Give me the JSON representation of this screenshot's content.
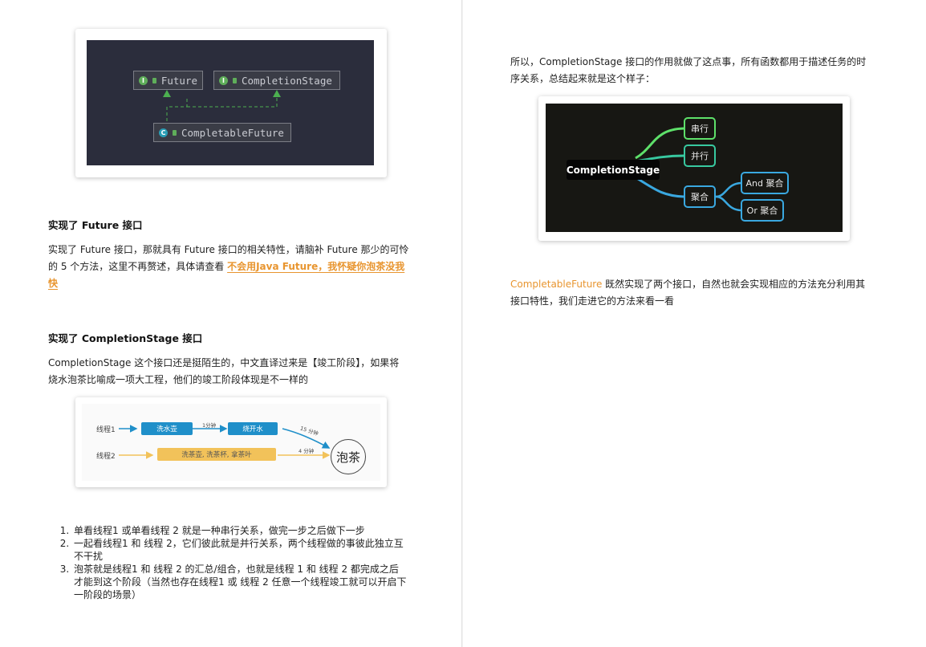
{
  "left_page": {
    "uml_figure": {
      "future": "Future",
      "completion_stage": "CompletionStage",
      "completable_future": "CompletableFuture",
      "interface_icon_letter": "I",
      "class_icon_letter": "C"
    },
    "section1": {
      "heading": "实现了 Future 接口",
      "para_line1": "实现了 Future 接口，那就具有 Future 接口的相关特性，请脑补 Future 那少的可怜",
      "para_line2_prefix": "的 5 个方法，这里不再赘述，具体请查看 ",
      "link_line1": "不会用Java Future，我怀疑你泡茶没我",
      "link_line2": "快"
    },
    "section2": {
      "heading": "实现了 CompletionStage 接口",
      "para_line1": "CompletionStage 这个接口还是挺陌生的，中文直译过来是【竣工阶段】，如果将",
      "para_line2": "烧水泡茶比喻成一项大工程，他们的竣工阶段体现是不一样的"
    },
    "tea_figure": {
      "thread1_label": "线程1",
      "thread2_label": "线程2",
      "step_wash_kettle": "洗水壶",
      "step_boil_water": "烧开水",
      "step_thread2": "洗茶壶, 洗茶杯, 拿茶叶",
      "time_1min": "1分钟",
      "time_15min": "15 分钟",
      "time_4min": "4 分钟",
      "result": "泡茶",
      "colors": {
        "blue": "#1f8fc9",
        "yellow": "#f2c25a"
      }
    },
    "list": [
      {
        "lines": [
          "单看线程1 或单看线程 2 就是一种串行关系，做完一步之后做下一步"
        ]
      },
      {
        "lines": [
          "一起看线程1 和 线程 2，它们彼此就是并行关系，两个线程做的事彼此独立互",
          "不干扰"
        ]
      },
      {
        "lines": [
          "泡茶就是线程1 和 线程 2 的汇总/组合，也就是线程 1 和 线程 2 都完成之后",
          "才能到这个阶段（当然也存在线程1 或 线程 2 任意一个线程竣工就可以开启下",
          "一阶段的场景）"
        ]
      }
    ]
  },
  "right_page": {
    "intro_line1": "所以，CompletionStage 接口的作用就做了这点事，所有函数都用于描述任务的时",
    "intro_line2": "序关系，总结起来就是这个样子：",
    "mindmap": {
      "root": "CompletionStage",
      "serial": "串行",
      "parallel": "并行",
      "aggregate": "聚合",
      "and_aggregate": "And 聚合",
      "or_aggregate": "Or 聚合",
      "colors": {
        "green": "#5ee06a",
        "teal": "#38c9a0",
        "blue": "#3aa8e0"
      }
    },
    "para_highlight": "CompletableFuture",
    "para_line1_rest": " 既然实现了两个接口，自然也就会实现相应的方法充分利用其",
    "para_line2": "接口特性，我们走进它的方法来看一看"
  }
}
